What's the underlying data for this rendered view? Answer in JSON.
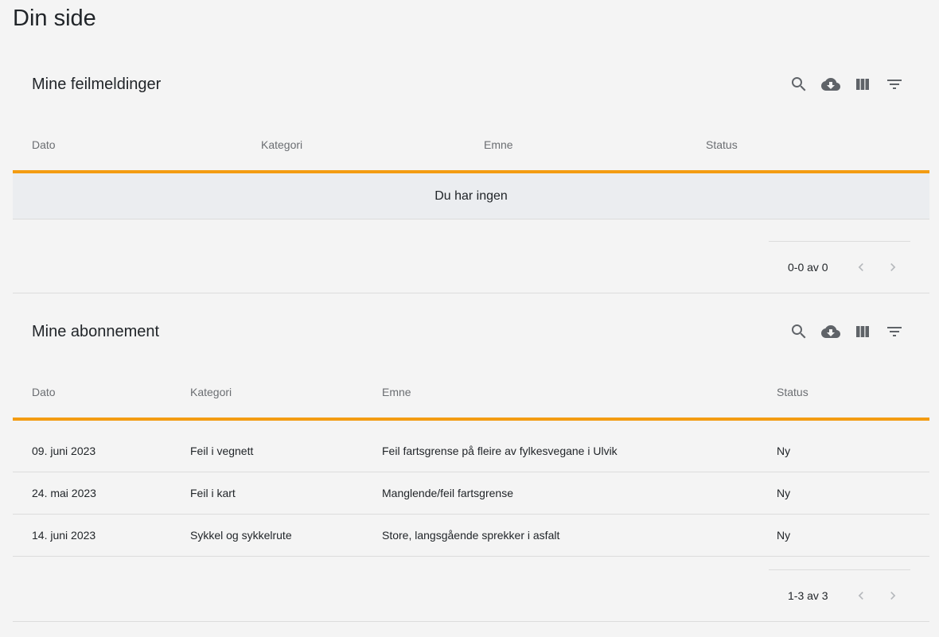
{
  "page": {
    "title": "Din side"
  },
  "reports": {
    "title": "Mine feilmeldinger",
    "columns": [
      "Dato",
      "Kategori",
      "Emne",
      "Status"
    ],
    "empty_text": "Du har ingen",
    "pagination": "0-0 av 0"
  },
  "subscriptions": {
    "title": "Mine abonnement",
    "columns": [
      "Dato",
      "Kategori",
      "Emne",
      "Status"
    ],
    "rows": [
      [
        "09. juni 2023",
        "Feil i vegnett",
        "Feil fartsgrense på fleire av fylkesvegane i Ulvik",
        "Ny"
      ],
      [
        "24. mai 2023",
        "Feil i kart",
        "Manglende/feil fartsgrense",
        "Ny"
      ],
      [
        "14. juni 2023",
        "Sykkel og sykkelrute",
        "Store, langsgående sprekker i asfalt",
        "Ny"
      ]
    ],
    "pagination": "1-3 av 3"
  },
  "toolbar_icons": [
    "search-icon",
    "download-icon",
    "view-columns-icon",
    "filter-icon"
  ],
  "colors": {
    "accent": "#f39c12",
    "background": "#f4f4f4",
    "empty_row": "#ebedf0"
  }
}
